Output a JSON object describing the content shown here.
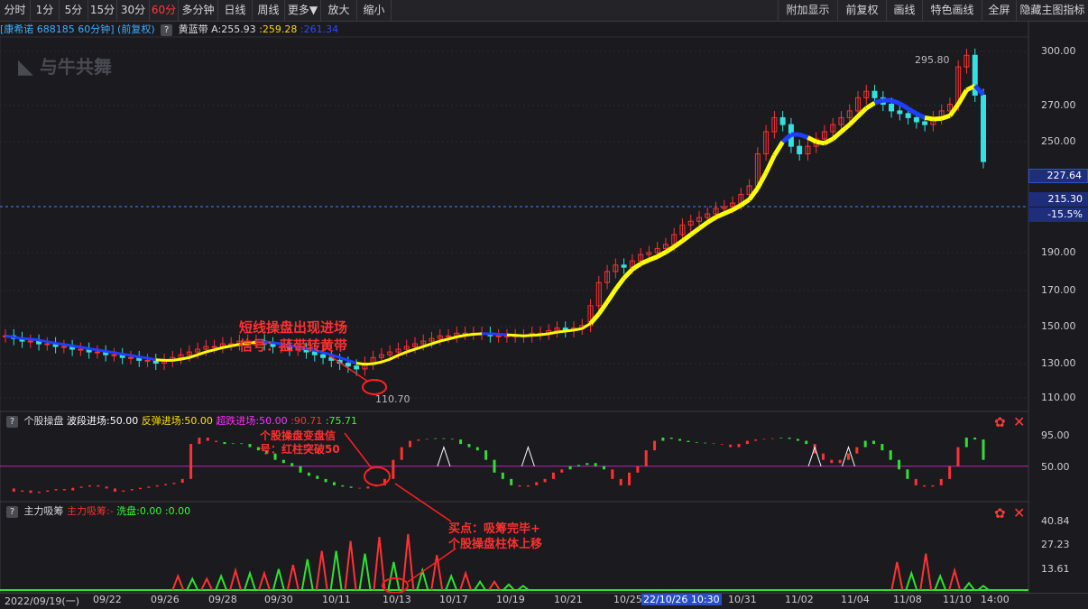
{
  "toolbar": {
    "left": [
      "分时",
      "1分",
      "5分",
      "15分",
      "30分",
      "60分",
      "多分钟",
      "日线",
      "周线",
      "更多▼",
      "放大",
      "缩小"
    ],
    "active_index": 5,
    "right": [
      "附加显示",
      "前复权",
      "画线",
      "特色画线",
      "全屏",
      "隐藏主图指标"
    ]
  },
  "info": {
    "stock": "[康希诺 688185 60分钟] (前复权)",
    "indicator": "黄蓝带",
    "a": "A:255.93",
    "b": ":259.28",
    "c": ":261.34"
  },
  "watermark": "与牛共舞",
  "sub1": {
    "name": "个股操盘",
    "l1": "波段进场:50.00",
    "l2": "反弹进场:50.00",
    "l3": "超跌进场:50.00",
    "v1": ":90.71",
    "v2": ":75.71"
  },
  "sub2": {
    "name": "主力吸筹",
    "l1": "主力吸筹:-",
    "l2": "洗盘:0.00",
    "l3": ":0.00"
  },
  "annotations": {
    "a1": "短线操盘出现进场\n信号：蓝带转黄带",
    "a2": "个股操盘变盘信\n号：红柱突破50",
    "a3": "买点：吸筹完毕+\n个股操盘柱体上移"
  },
  "price_axis": {
    "ticks": [
      "300.00",
      "270.00",
      "250.00",
      "190.00",
      "170.00",
      "150.00",
      "130.00",
      "110.00"
    ],
    "current": "227.64",
    "crosshair": "215.30",
    "crosshair_pct": "-15.5%"
  },
  "sub1_axis": [
    "95.00",
    "50.00"
  ],
  "sub2_axis": [
    "40.84",
    "27.23",
    "13.61"
  ],
  "x_axis": [
    "2022/09/19(一)",
    "09/22",
    "09/26",
    "09/28",
    "09/30",
    "10/11",
    "10/13",
    "10/17",
    "10/19",
    "10/21",
    "10/25",
    "22/10/26 10:30",
    "10/31",
    "11/02",
    "11/04",
    "11/08",
    "11/10",
    "14:00"
  ],
  "x_highlight_index": 11,
  "colors": {
    "up": "#ff3232",
    "down": "#35e0e0",
    "yellow": "#ffff00",
    "blue": "#1f3fff",
    "accent": "#ff3b3b"
  },
  "chart_data": {
    "type": "candlestick",
    "title": "",
    "price_labels": {
      "high": "295.80",
      "low": "110.70"
    },
    "closes": [
      128,
      127,
      126,
      126,
      125,
      125,
      124,
      124,
      123,
      123,
      122,
      122,
      121,
      121,
      120,
      120,
      119,
      119,
      118,
      119,
      120,
      121,
      122,
      123,
      124,
      124,
      125,
      125,
      126,
      126,
      126,
      125,
      124,
      124,
      123,
      123,
      122,
      121,
      120,
      119,
      118,
      117,
      116,
      118,
      120,
      121,
      122,
      123,
      124,
      125,
      126,
      127,
      128,
      128,
      129,
      129,
      129,
      129,
      128,
      128,
      128,
      128,
      128,
      129,
      129,
      130,
      131,
      130,
      131,
      132,
      140,
      150,
      155,
      158,
      157,
      160,
      163,
      164,
      166,
      168,
      173,
      178,
      180,
      182,
      184,
      187,
      188,
      190,
      195,
      200,
      220,
      235,
      245,
      240,
      225,
      220,
      225,
      230,
      235,
      240,
      245,
      250,
      260,
      265,
      260,
      255,
      250,
      248,
      245,
      242,
      240,
      245,
      250,
      255,
      285,
      295,
      262,
      215
    ],
    "sub1_values": [
      15,
      10,
      12,
      8,
      10,
      12,
      14,
      12,
      16,
      18,
      20,
      18,
      15,
      10,
      12,
      14,
      16,
      18,
      20,
      22,
      24,
      30,
      85,
      95,
      90,
      88,
      85,
      86,
      85,
      80,
      75,
      70,
      60,
      55,
      50,
      40,
      35,
      30,
      25,
      20,
      18,
      16,
      15,
      18,
      20,
      30,
      60,
      80,
      90,
      92,
      93,
      94,
      93,
      92,
      85,
      80,
      75,
      60,
      40,
      30,
      20,
      18,
      20,
      25,
      30,
      40,
      45,
      50,
      52,
      55,
      50,
      45,
      30,
      20,
      40,
      50,
      75,
      90,
      95,
      93,
      90,
      88,
      87,
      86,
      85,
      84,
      80,
      85,
      90,
      92,
      93,
      94,
      95,
      93,
      90,
      85,
      70,
      60,
      55,
      60,
      70,
      80,
      90,
      85,
      75,
      60,
      45,
      30,
      20,
      18,
      20,
      30,
      50,
      80,
      95,
      92,
      60
    ],
    "sub1_colors": "rrrrrrrrrrrrrrrrrrrrrrrrrrggggggggggggggggrrrrrrrrrggggggggggrrrrrrgggggrrrrrrggggggrrrrrrrrggggrrrrrrggggggrrrrrrgg",
    "sub1_triangles": [
      52,
      62,
      96,
      100
    ],
    "sub2_red": [
      [
        12,
        10
      ],
      [
        14,
        8
      ],
      [
        16,
        14
      ],
      [
        18,
        12
      ],
      [
        20,
        18
      ],
      [
        22,
        28
      ],
      [
        24,
        35
      ],
      [
        26,
        38
      ],
      [
        28,
        40
      ],
      [
        30,
        25
      ],
      [
        32,
        12
      ],
      [
        34,
        6
      ],
      [
        62,
        20
      ],
      [
        64,
        26
      ],
      [
        66,
        14
      ]
    ],
    "sub2_green": [
      [
        13,
        8
      ],
      [
        15,
        10
      ],
      [
        17,
        12
      ],
      [
        19,
        15
      ],
      [
        21,
        22
      ],
      [
        23,
        28
      ],
      [
        25,
        26
      ],
      [
        27,
        20
      ],
      [
        29,
        14
      ],
      [
        31,
        10
      ],
      [
        33,
        6
      ],
      [
        35,
        4
      ],
      [
        36,
        3
      ],
      [
        63,
        12
      ],
      [
        65,
        10
      ],
      [
        67,
        5
      ],
      [
        68,
        3
      ]
    ]
  }
}
